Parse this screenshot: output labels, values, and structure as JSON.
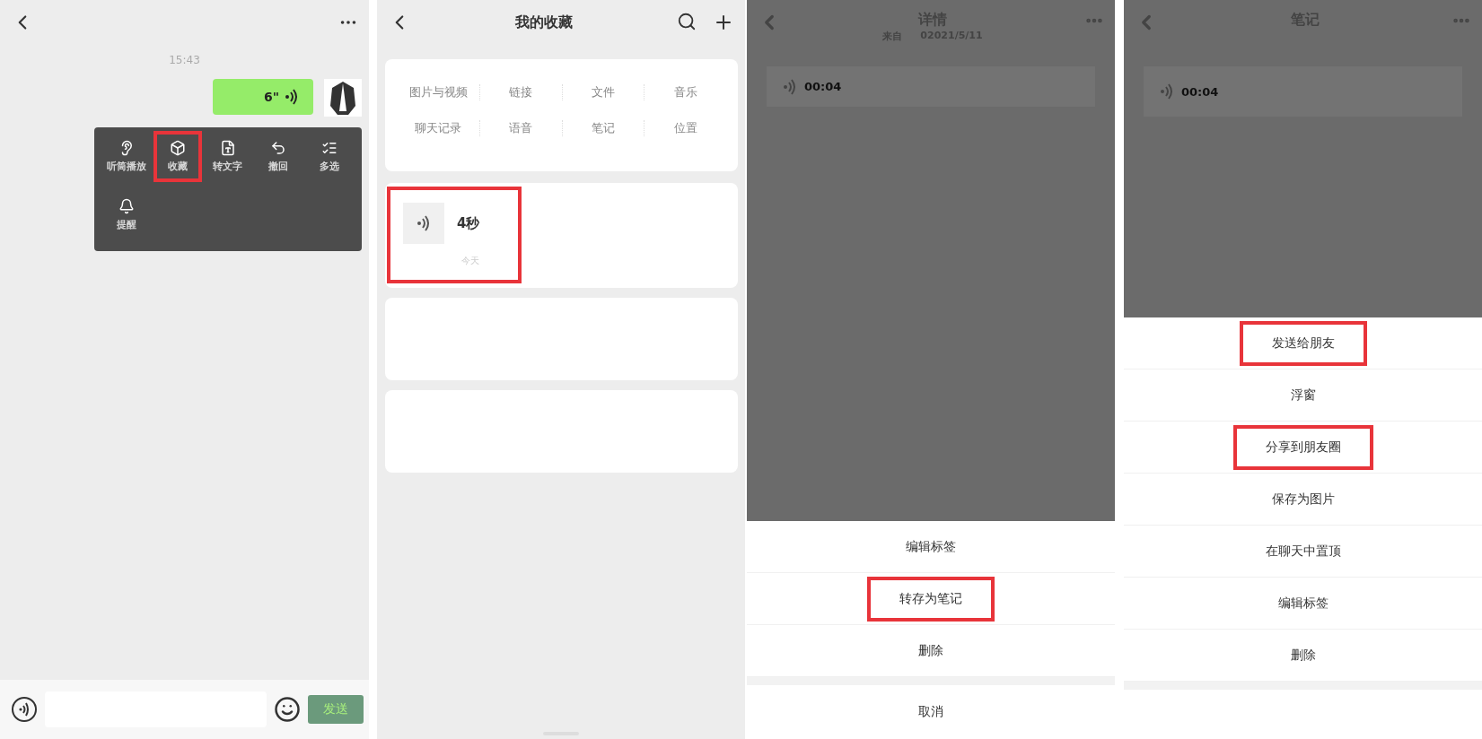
{
  "panels": [
    {
      "kind": "chat",
      "time": "15:43",
      "message": {
        "duration": "6\""
      },
      "menu": {
        "items": [
          {
            "kind": "ear",
            "label": "听筒播放",
            "highlighted": false
          },
          {
            "kind": "cube",
            "label": "收藏",
            "highlighted": true
          },
          {
            "kind": "text",
            "label": "转文字",
            "highlighted": false
          },
          {
            "kind": "undo",
            "label": "撤回",
            "highlighted": false
          },
          {
            "kind": "list",
            "label": "多选",
            "highlighted": false
          },
          {
            "kind": "bell",
            "label": "提醒",
            "highlighted": false
          }
        ]
      },
      "composer": {
        "send": "发送"
      }
    },
    {
      "kind": "favorites",
      "title": "我的收藏",
      "categories": [
        "图片与视频",
        "链接",
        "文件",
        "音乐",
        "聊天记录",
        "语音",
        "笔记",
        "位置"
      ],
      "items": [
        {
          "kind": "voice",
          "duration": "4秒",
          "date": "今天",
          "highlighted": true
        },
        {
          "kind": "blank"
        },
        {
          "kind": "blank"
        }
      ]
    },
    {
      "kind": "detail",
      "title": "详情",
      "source_label": "来自",
      "source_date": "02021/5/11",
      "voice": "00:04",
      "sheet": [
        {
          "label": "编辑标签",
          "highlighted": false
        },
        {
          "label": "转存为笔记",
          "highlighted": true
        },
        {
          "label": "删除",
          "highlighted": false
        }
      ],
      "cancel": "取消"
    },
    {
      "kind": "note",
      "title": "笔记",
      "voice": "00:04",
      "sheet": [
        {
          "label": "发送给朋友",
          "highlighted": true
        },
        {
          "label": "浮窗",
          "highlighted": false
        },
        {
          "label": "分享到朋友圈",
          "highlighted": true
        },
        {
          "label": "保存为图片",
          "highlighted": false
        },
        {
          "label": "在聊天中置顶",
          "highlighted": false
        },
        {
          "label": "编辑标签",
          "highlighted": false
        },
        {
          "label": "删除",
          "highlighted": false
        }
      ]
    }
  ]
}
